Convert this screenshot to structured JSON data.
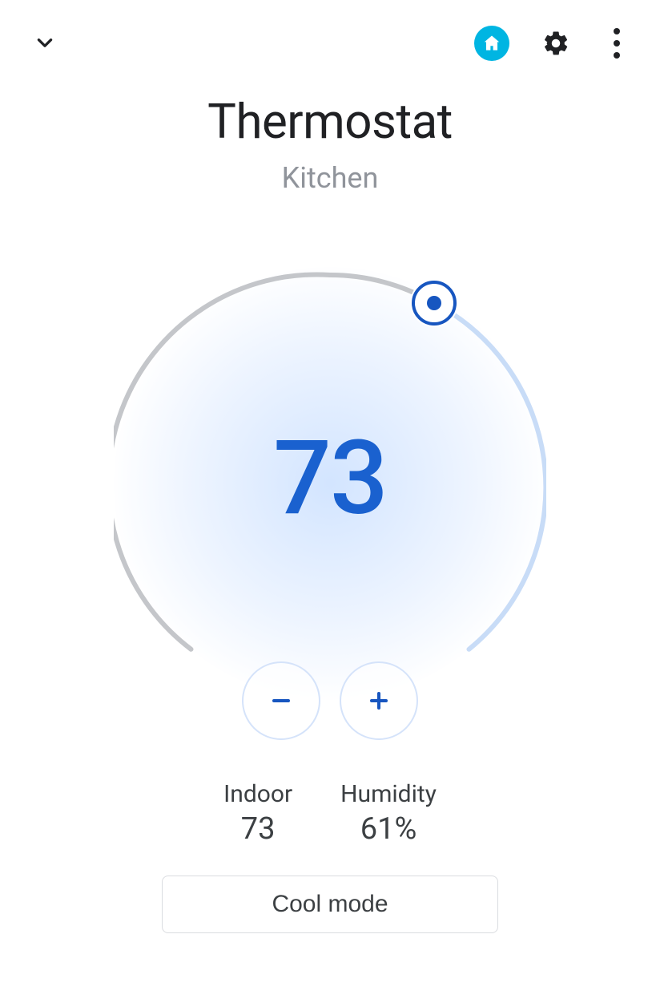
{
  "header": {
    "title": "Thermostat",
    "subtitle": "Kitchen"
  },
  "dial": {
    "setpoint": "73",
    "handle_angle_deg": 30
  },
  "stats": {
    "indoor": {
      "label": "Indoor",
      "value": "73"
    },
    "humidity": {
      "label": "Humidity",
      "value": "61%"
    }
  },
  "mode_button": {
    "label": "Cool mode"
  },
  "colors": {
    "accent_blue": "#1a61cf",
    "teal": "#00B5E2",
    "light_blue_ring": "#c8dcf7",
    "grey_ring": "#c4c6ca"
  }
}
